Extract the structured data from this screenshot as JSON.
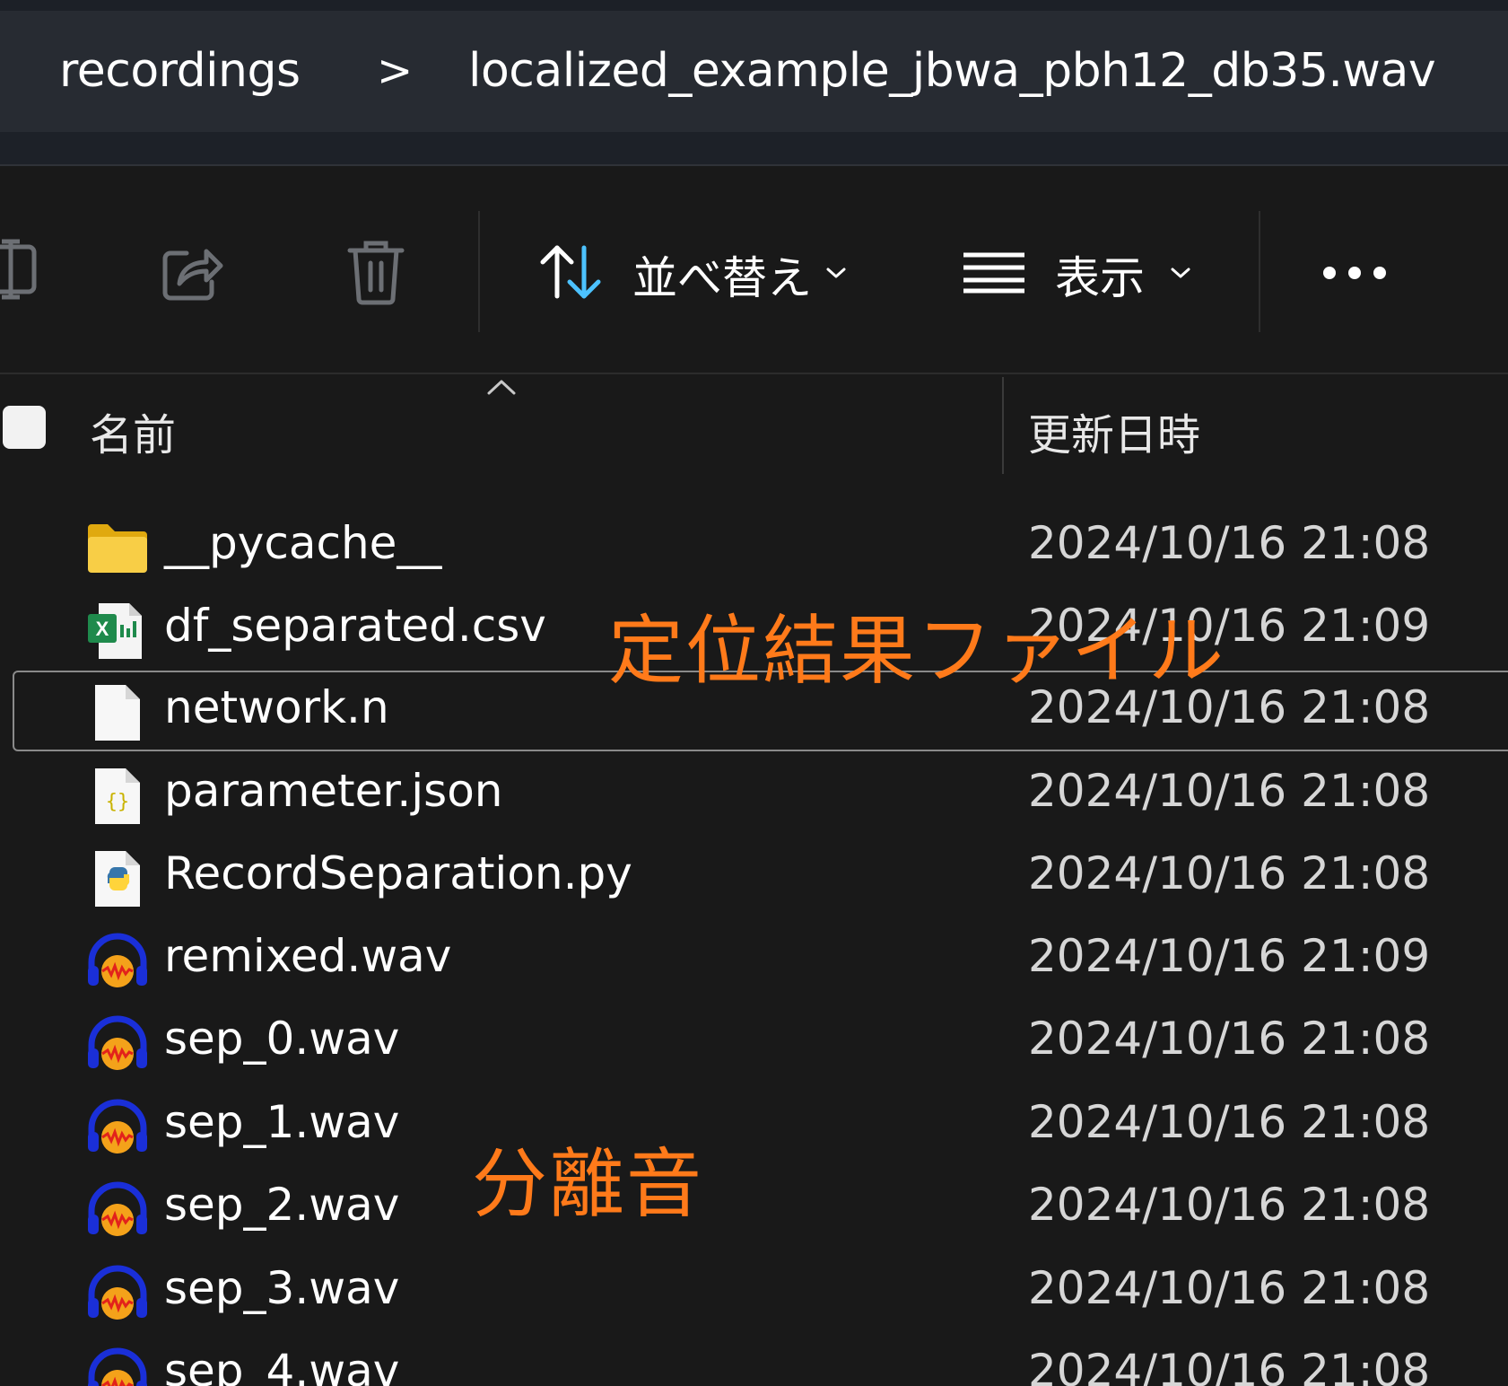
{
  "breadcrumb": {
    "items": [
      "recordings",
      "localized_example_jbwa_pbh12_db35.wav"
    ],
    "separator": ">"
  },
  "toolbar": {
    "sort_label": "並べ替え",
    "view_label": "表示",
    "more_icon": "ellipsis-icon"
  },
  "columns": {
    "name": "名前",
    "modified": "更新日時"
  },
  "files": [
    {
      "name": "__pycache__",
      "date": "2024/10/16 21:08",
      "icon": "folder"
    },
    {
      "name": "df_separated.csv",
      "date": "2024/10/16 21:09",
      "icon": "excel"
    },
    {
      "name": "network.n",
      "date": "2024/10/16 21:08",
      "icon": "file"
    },
    {
      "name": "parameter.json",
      "date": "2024/10/16 21:08",
      "icon": "json"
    },
    {
      "name": "RecordSeparation.py",
      "date": "2024/10/16 21:08",
      "icon": "python"
    },
    {
      "name": "remixed.wav",
      "date": "2024/10/16 21:09",
      "icon": "audio"
    },
    {
      "name": "sep_0.wav",
      "date": "2024/10/16 21:08",
      "icon": "audio"
    },
    {
      "name": "sep_1.wav",
      "date": "2024/10/16 21:08",
      "icon": "audio"
    },
    {
      "name": "sep_2.wav",
      "date": "2024/10/16 21:08",
      "icon": "audio"
    },
    {
      "name": "sep_3.wav",
      "date": "2024/10/16 21:08",
      "icon": "audio"
    },
    {
      "name": "sep_4.wav",
      "date": "2024/10/16 21:08",
      "icon": "audio"
    }
  ],
  "annotations": {
    "localization_result_file": "定位結果ファイル",
    "separated_sound": "分離音"
  },
  "colors": {
    "annotation": "#ff7a1a",
    "breadcrumb_bg": "#272b32",
    "background": "#191919"
  }
}
